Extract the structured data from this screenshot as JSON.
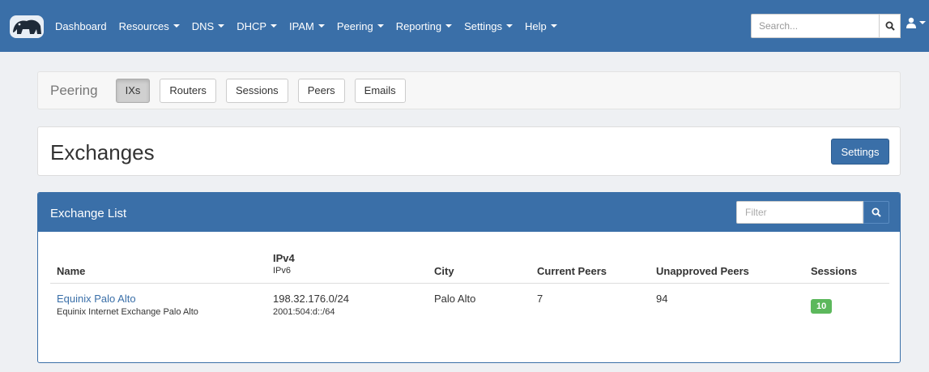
{
  "nav": {
    "items": [
      {
        "label": "Dashboard",
        "dropdown": false
      },
      {
        "label": "Resources",
        "dropdown": true
      },
      {
        "label": "DNS",
        "dropdown": true
      },
      {
        "label": "DHCP",
        "dropdown": true
      },
      {
        "label": "IPAM",
        "dropdown": true
      },
      {
        "label": "Peering",
        "dropdown": true
      },
      {
        "label": "Reporting",
        "dropdown": true
      },
      {
        "label": "Settings",
        "dropdown": true
      },
      {
        "label": "Help",
        "dropdown": true
      }
    ],
    "search_placeholder": "Search...",
    "colors": {
      "navbar": "#3a6fa8"
    }
  },
  "page_nav": {
    "title": "Peering",
    "tabs": [
      {
        "label": "IXs",
        "active": true
      },
      {
        "label": "Routers",
        "active": false
      },
      {
        "label": "Sessions",
        "active": false
      },
      {
        "label": "Peers",
        "active": false
      },
      {
        "label": "Emails",
        "active": false
      }
    ]
  },
  "header": {
    "title": "Exchanges",
    "settings_label": "Settings"
  },
  "exchange_list": {
    "title": "Exchange List",
    "filter_placeholder": "Filter",
    "columns": {
      "name": "Name",
      "ipv4": "IPv4",
      "ipv6": "IPv6",
      "city": "City",
      "current_peers": "Current Peers",
      "unapproved_peers": "Unapproved Peers",
      "sessions": "Sessions"
    },
    "rows": [
      {
        "name": "Equinix Palo Alto",
        "description": "Equinix Internet Exchange Palo Alto",
        "ipv4": "198.32.176.0/24",
        "ipv6": "2001:504:d::/64",
        "city": "Palo Alto",
        "current_peers": "7",
        "unapproved_peers": "94",
        "sessions": "10"
      }
    ],
    "colors": {
      "badge": "#5cb85c",
      "link": "#3a6fa8"
    }
  }
}
